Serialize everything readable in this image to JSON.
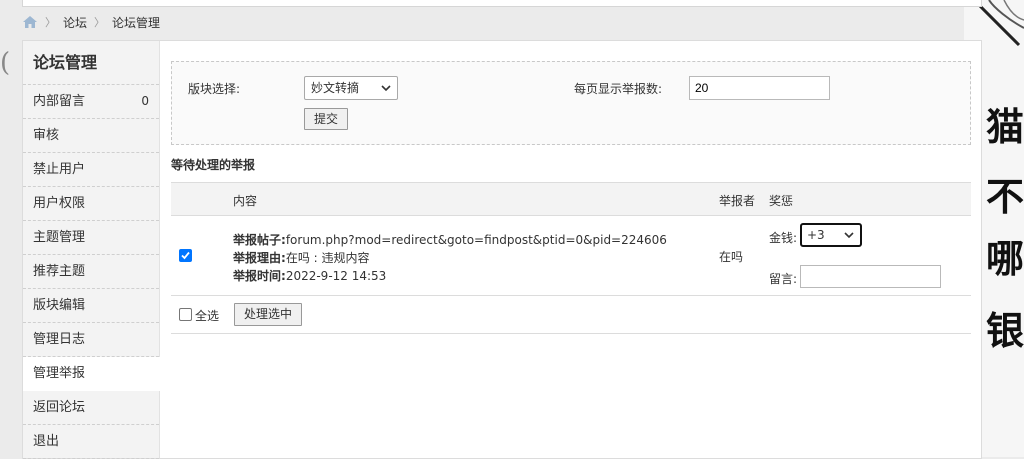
{
  "breadcrumb": {
    "items": [
      "论坛",
      "论坛管理"
    ]
  },
  "sidebar": {
    "title": "论坛管理",
    "items": [
      {
        "label": "内部留言",
        "count": "0"
      },
      {
        "label": "审核"
      },
      {
        "label": "禁止用户"
      },
      {
        "label": "用户权限"
      },
      {
        "label": "主题管理"
      },
      {
        "label": "推荐主题"
      },
      {
        "label": "版块编辑"
      },
      {
        "label": "管理日志"
      },
      {
        "label": "管理举报",
        "active": true
      },
      {
        "label": "返回论坛"
      },
      {
        "label": "退出"
      }
    ]
  },
  "filter": {
    "board_label": "版块选择:",
    "board_value": "妙文转摘",
    "per_page_label": "每页显示举报数:",
    "per_page_value": "20",
    "submit_label": "提交"
  },
  "reports": {
    "section_title": "等待处理的举报",
    "headers": {
      "content": "内容",
      "reporter": "举报者",
      "reward": "奖惩"
    },
    "rows": [
      {
        "checked": true,
        "post_label": "举报帖子:",
        "post_value": "forum.php?mod=redirect&goto=findpost&ptid=0&pid=224606",
        "reason_label": "举报理由:",
        "reason_value": "在吗 : 违规内容",
        "time_label": "举报时间:",
        "time_value": "2022-9-12 14:53",
        "reporter": "在吗",
        "money_label": "金钱:",
        "money_value": "+3",
        "message_label": "留言:",
        "message_value": ""
      }
    ],
    "select_all_label": "全选",
    "process_label": "处理选中"
  },
  "background_glyphs": [
    "猫",
    "不",
    "哪",
    "银"
  ],
  "colors": {
    "accent_checkbox": "#0075ff"
  }
}
